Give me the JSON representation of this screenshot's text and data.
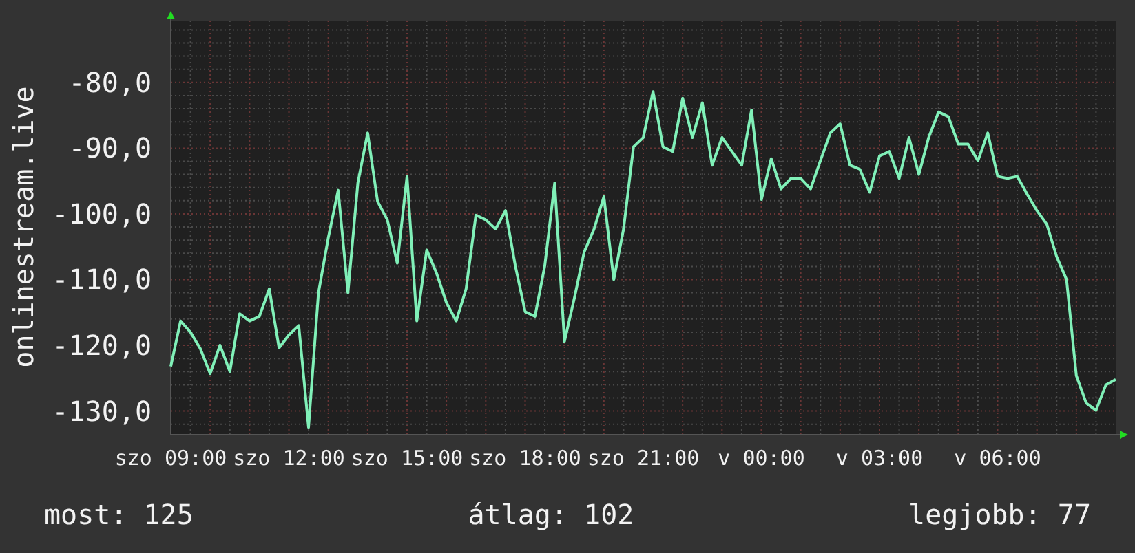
{
  "chart": {
    "chart_data": {
      "type": "line",
      "ylabel": "onlinestream.live",
      "categories": [
        "szo 09:00",
        null,
        null,
        null,
        null,
        null,
        null,
        null,
        null,
        null,
        null,
        null,
        "szo 12:00",
        null,
        null,
        null,
        null,
        null,
        null,
        null,
        null,
        null,
        null,
        null,
        "szo 15:00",
        null,
        null,
        null,
        null,
        null,
        null,
        null,
        null,
        null,
        null,
        null,
        "szo 18:00",
        null,
        null,
        null,
        null,
        null,
        null,
        null,
        null,
        null,
        null,
        null,
        "szo 21:00",
        null,
        null,
        null,
        null,
        null,
        null,
        null,
        null,
        null,
        null,
        null,
        "v 00:00",
        null,
        null,
        null,
        null,
        null,
        null,
        null,
        null,
        null,
        null,
        null,
        "v 03:00",
        null,
        null,
        null,
        null,
        null,
        null,
        null,
        null,
        null,
        null,
        null,
        "v 06:00",
        null,
        null,
        null,
        null,
        null,
        null,
        null,
        null,
        null,
        null,
        null,
        null
      ],
      "series": [
        {
          "color": "#80f0b8",
          "values": [
            -123.2,
            -116.3,
            -118,
            -120.5,
            -124.3,
            -120,
            -124,
            -115.2,
            -116.3,
            -115.6,
            -111.4,
            -120.4,
            -118.4,
            -117,
            -132.5,
            -112,
            -103.7,
            -96.4,
            -112,
            -95.3,
            -87.7,
            -98.1,
            -100.9,
            -107.5,
            -94.3,
            -116.3,
            -105.5,
            -109,
            -113.5,
            -116.3,
            -111.4,
            -100.2,
            -100.9,
            -102.3,
            -99.5,
            -107.9,
            -114.9,
            -115.6,
            -107.9,
            -95.3,
            -119.4,
            -112.8,
            -105.8,
            -102.3,
            -97.4,
            -110,
            -102.3,
            -89.8,
            -88.4,
            -81.4,
            -89.8,
            -90.5,
            -82.4,
            -88.4,
            -83.1,
            -92.6,
            -88.4,
            -90.5,
            -92.6,
            -84.2,
            -97.8,
            -91.6,
            -96.2,
            -94.6,
            -94.6,
            -96.2,
            -91.9,
            -87.7,
            -86.3,
            -92.6,
            -93.2,
            -96.7,
            -91.2,
            -90.5,
            -94.6,
            -88.4,
            -94,
            -88.4,
            -84.5,
            -85.2,
            -89.4,
            -89.4,
            -91.9,
            -87.7,
            -94.3,
            -94.6,
            -94.3,
            -97,
            -99.5,
            -101.6,
            -106.5,
            -110,
            -124.6,
            -128.8,
            -129.9,
            -126,
            -125.2
          ]
        }
      ],
      "ylim": [
        -133.6,
        -70.6
      ],
      "grid": true,
      "yticks": [
        {
          "value": -130,
          "label": "-130,0"
        },
        {
          "value": -120,
          "label": "-120,0"
        },
        {
          "value": -110,
          "label": "-110,0"
        },
        {
          "value": -100,
          "label": "-100,0"
        },
        {
          "value": -90,
          "label": "-90,0"
        },
        {
          "value": -80,
          "label": "-80,0"
        }
      ]
    }
  },
  "stats": [
    "most: 125",
    "átlag: 102",
    "legjobb: 77"
  ]
}
